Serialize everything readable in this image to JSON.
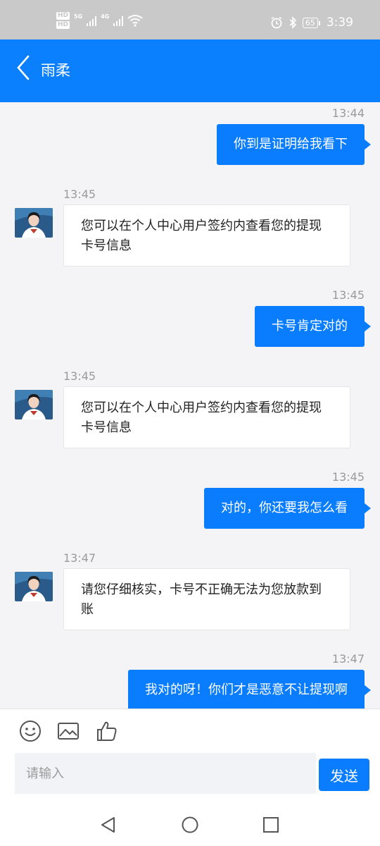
{
  "status_bar": {
    "hd_badge_1": "HD",
    "hd_badge_2": "HD",
    "network_1": "5G",
    "network_2": "4G",
    "battery": "65",
    "time": "3:39"
  },
  "header": {
    "title": "雨柔"
  },
  "messages": [
    {
      "sender": "me",
      "time": "13:44",
      "text": "你到是证明给我看下"
    },
    {
      "sender": "agent",
      "time": "13:45",
      "text": "您可以在个人中心用户签约内查看您的提现卡号信息"
    },
    {
      "sender": "me",
      "time": "13:45",
      "text": "卡号肯定对的"
    },
    {
      "sender": "agent",
      "time": "13:45",
      "text": "您可以在个人中心用户签约内查看您的提现卡号信息"
    },
    {
      "sender": "me",
      "time": "13:45",
      "text": "对的，你还要我怎么看"
    },
    {
      "sender": "agent",
      "time": "13:47",
      "text": "请您仔细核实，卡号不正确无法为您放款到账"
    },
    {
      "sender": "me",
      "time": "13:47",
      "text": "我对的呀！你们才是恶意不让提现啊"
    }
  ],
  "input": {
    "placeholder": "请输入",
    "value": "",
    "send_label": "发送"
  },
  "toolbar_icons": [
    "smiley-icon",
    "image-icon",
    "thumbs-up-icon"
  ],
  "nav_icons": [
    "back-triangle-icon",
    "home-circle-icon",
    "recents-square-icon"
  ],
  "colors": {
    "accent": "#0a80ff",
    "outgoing_bubble": "#0a7dff",
    "background": "#f4f4f6"
  }
}
